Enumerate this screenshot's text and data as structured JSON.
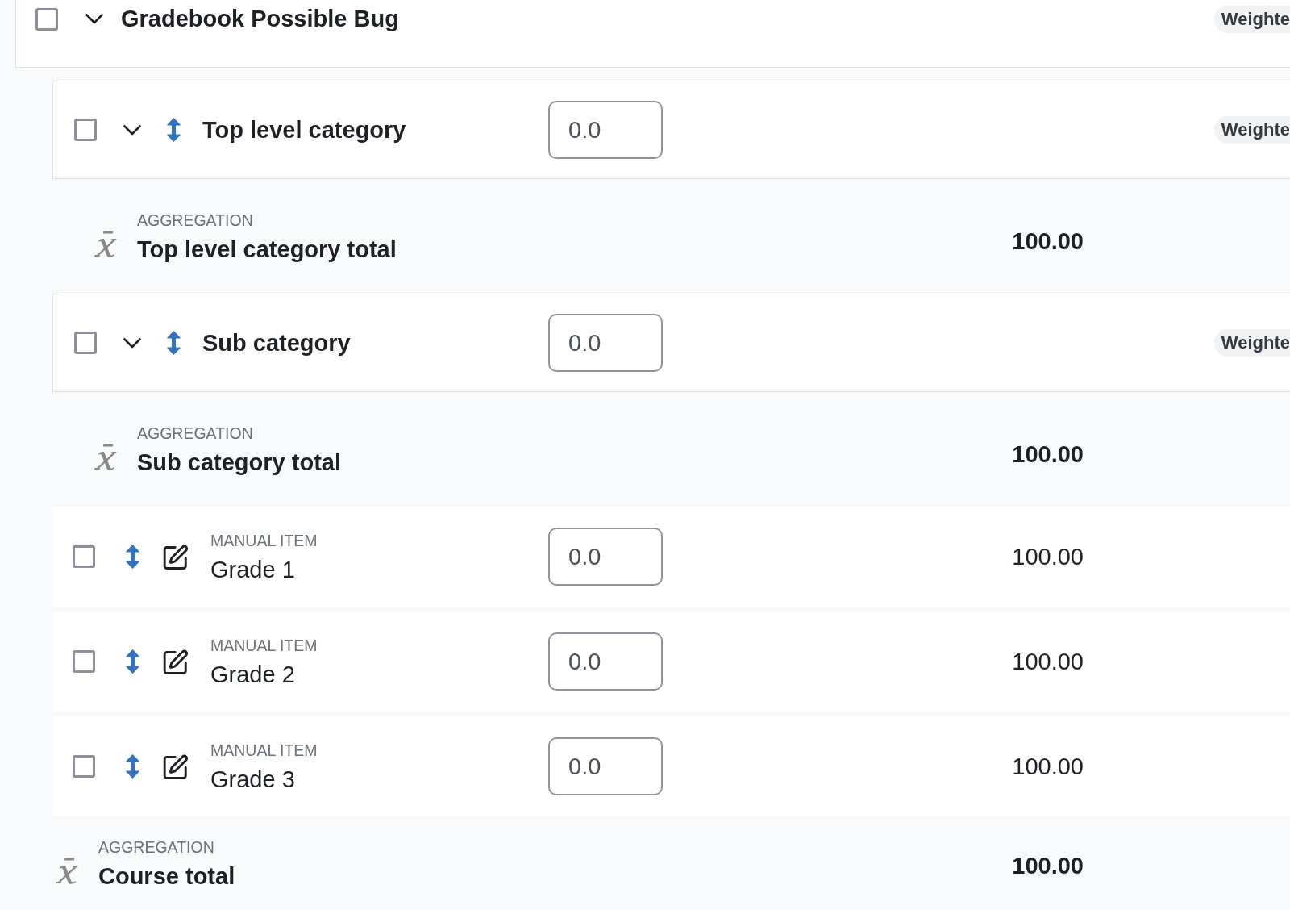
{
  "course": {
    "name": "Gradebook Possible Bug",
    "checked": false,
    "expanded": true,
    "badge": "Weighte",
    "children": [
      {
        "kind": "category",
        "name": "Top level category",
        "checked": false,
        "expanded": true,
        "value": "0.0",
        "badge": "Weighte",
        "children": [
          {
            "kind": "total",
            "type_label": "AGGREGATION",
            "name": "Top level category total",
            "max": "100.00"
          }
        ]
      },
      {
        "kind": "category",
        "name": "Sub category",
        "checked": false,
        "expanded": true,
        "value": "0.0",
        "badge": "Weighte",
        "children": [
          {
            "kind": "total",
            "type_label": "AGGREGATION",
            "name": "Sub category total",
            "max": "100.00"
          }
        ]
      },
      {
        "kind": "item",
        "type_label": "MANUAL ITEM",
        "name": "Grade 1",
        "checked": false,
        "value": "0.0",
        "max": "100.00"
      },
      {
        "kind": "item",
        "type_label": "MANUAL ITEM",
        "name": "Grade 2",
        "checked": false,
        "value": "0.0",
        "max": "100.00"
      },
      {
        "kind": "item",
        "type_label": "MANUAL ITEM",
        "name": "Grade 3",
        "checked": false,
        "value": "0.0",
        "max": "100.00"
      },
      {
        "kind": "total",
        "type_label": "AGGREGATION",
        "name": "Course total",
        "max": "100.00"
      }
    ]
  }
}
